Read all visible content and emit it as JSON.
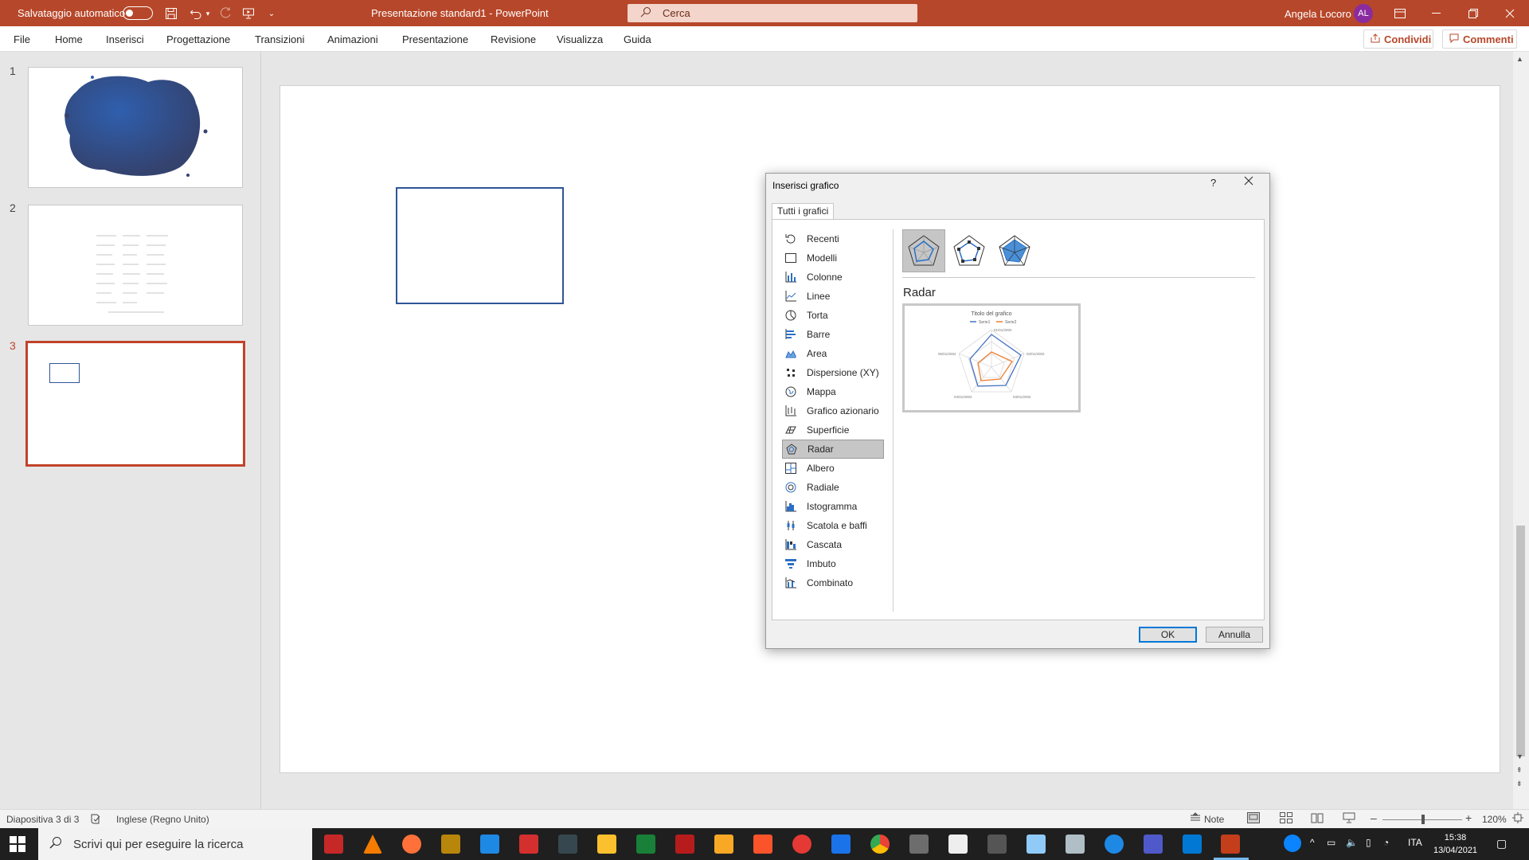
{
  "titlebar": {
    "autosave_label": "Salvataggio automatico",
    "document_title": "Presentazione standard1  -  PowerPoint",
    "search_placeholder": "Cerca",
    "user_name": "Angela Locoro",
    "user_initials": "AL"
  },
  "ribbon": {
    "tabs": [
      "File",
      "Home",
      "Inserisci",
      "Progettazione",
      "Transizioni",
      "Animazioni",
      "Presentazione",
      "Revisione",
      "Visualizza",
      "Guida"
    ],
    "share_label": "Condividi",
    "comments_label": "Commenti"
  },
  "thumbnails": [
    {
      "number": "1"
    },
    {
      "number": "2"
    },
    {
      "number": "3"
    }
  ],
  "statusbar": {
    "slide_info": "Diapositiva 3 di 3",
    "language": "Inglese (Regno Unito)",
    "notes_label": "Note",
    "zoom": "120%"
  },
  "taskbar": {
    "search_placeholder": "Scrivi qui per eseguire la ricerca",
    "language": "ITA",
    "time": "15:38",
    "date": "13/04/2021"
  },
  "dialog": {
    "title": "Inserisci grafico",
    "help": "?",
    "tab_label": "Tutti i grafici",
    "categories": [
      "Recenti",
      "Modelli",
      "Colonne",
      "Linee",
      "Torta",
      "Barre",
      "Area",
      "Dispersione (XY)",
      "Mappa",
      "Grafico azionario",
      "Superficie",
      "Radar",
      "Albero",
      "Radiale",
      "Istogramma",
      "Scatola e baffi",
      "Cascata",
      "Imbuto",
      "Combinato"
    ],
    "selected_category": "Radar",
    "subtype_heading": "Radar",
    "preview_title": "Titolo del grafico",
    "preview_legend": [
      "Serie1",
      "Serie2"
    ],
    "preview_axis_labels": [
      "01/01/2002",
      "02/01/2002",
      "03/01/2002",
      "04/01/2002",
      "05/01/2002"
    ],
    "ok_label": "OK",
    "cancel_label": "Annulla"
  },
  "colors": {
    "brand": "#b7472a",
    "slide_border": "#2f5597",
    "selection": "#c6c6c6"
  }
}
